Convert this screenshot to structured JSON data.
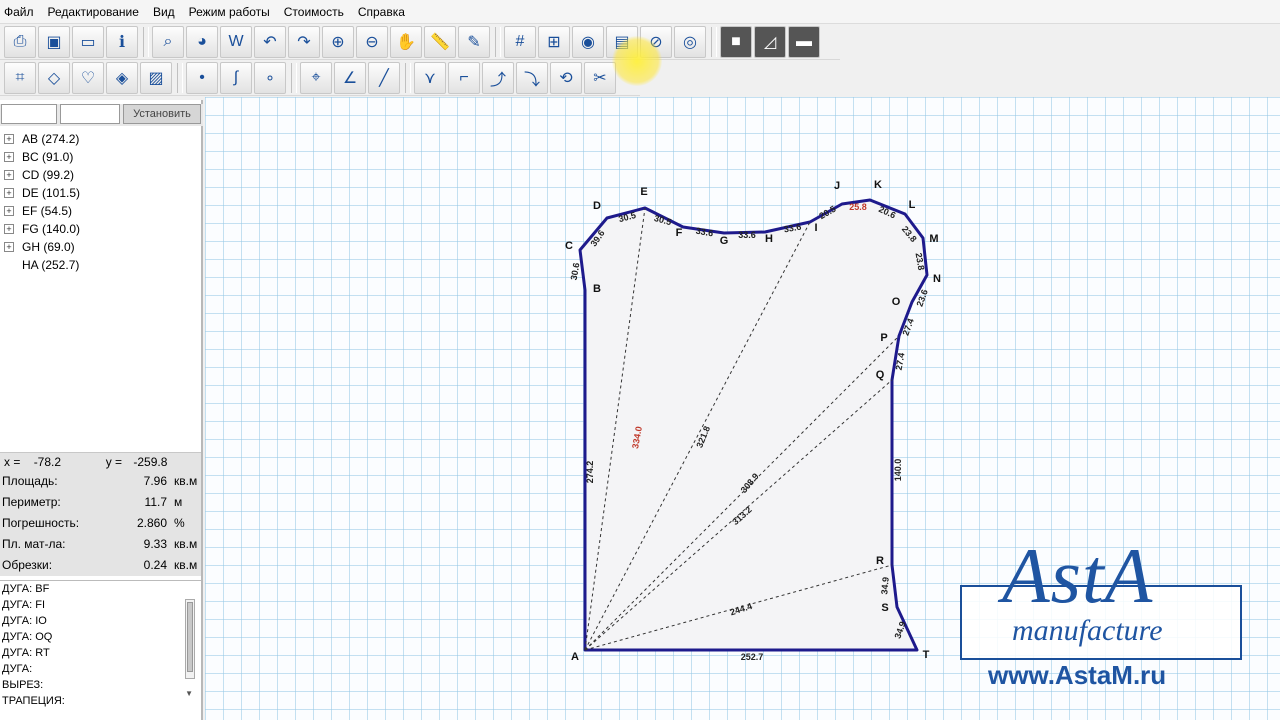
{
  "menu": [
    "Файл",
    "Редактирование",
    "Вид",
    "Режим работы",
    "Стоимость",
    "Справка"
  ],
  "toolbar1_icons": [
    "new-pattern-icon",
    "save-icon",
    "open-folder-icon",
    "info-icon",
    "zoom-page-icon",
    "pot-icon",
    "w-tool-icon",
    "curve-left-icon",
    "curve-right-icon",
    "zoom-in-icon",
    "zoom-out-icon",
    "hand-icon",
    "ruler-icon",
    "brush-icon",
    "grid-icon",
    "snap-grid-icon",
    "eye-icon",
    "layer-eye-icon",
    "eye-slash-icon",
    "eye-alt-icon",
    "gray-square-icon",
    "slope-icon",
    "line-icon"
  ],
  "toolbar2_icons": [
    "frame-icon",
    "diamond-icon",
    "heart-icon",
    "diamond-outline-icon",
    "image-icon",
    "point-icon",
    "curve-tool-icon",
    "point2-icon",
    "pin-icon",
    "angle-icon",
    "line2-icon",
    "dart-icon",
    "step-icon",
    "arrow-path-icon",
    "arrow-path2-icon",
    "rotate-icon",
    "cut-icon"
  ],
  "setbar": {
    "input1": "",
    "input2": "",
    "button": "Установить"
  },
  "tree": [
    {
      "label": "AB (274.2)",
      "expandable": true
    },
    {
      "label": "BC (91.0)",
      "expandable": true
    },
    {
      "label": "CD (99.2)",
      "expandable": true
    },
    {
      "label": "DE (101.5)",
      "expandable": true
    },
    {
      "label": "EF (54.5)",
      "expandable": true
    },
    {
      "label": "FG (140.0)",
      "expandable": true
    },
    {
      "label": "GH (69.0)",
      "expandable": true
    },
    {
      "label": "HA (252.7)",
      "expandable": false
    }
  ],
  "coords": {
    "x_label": "x =",
    "x": "-78.2",
    "y_label": "y =",
    "y": "-259.8"
  },
  "stats": [
    {
      "label": "Площадь:",
      "value": "7.96",
      "unit": "кв.м"
    },
    {
      "label": "Периметр:",
      "value": "11.7",
      "unit": "м"
    },
    {
      "label": "Погрешность:",
      "value": "2.860",
      "unit": "%"
    },
    {
      "label": "Пл. мат-ла:",
      "value": "9.33",
      "unit": "кв.м"
    },
    {
      "label": "Обрезки:",
      "value": "0.24",
      "unit": "кв.м"
    }
  ],
  "log": [
    "ДУГА: BF",
    "ДУГА: FI",
    "ДУГА: IO",
    "ДУГА: OQ",
    "ДУГА: RT",
    "ДУГА:",
    "ВЫРЕЗ:",
    "ТРАПЕЦИЯ:"
  ],
  "points": {
    "A": "A",
    "B": "B",
    "C": "C",
    "D": "D",
    "E": "E",
    "F": "F",
    "G": "G",
    "H": "H",
    "I": "I",
    "J": "J",
    "K": "K",
    "L": "L",
    "M": "M",
    "N": "N",
    "O": "O",
    "P": "P",
    "Q": "Q",
    "R": "R",
    "S": "S",
    "T": "T"
  },
  "edge_labels": {
    "AB": "274.2",
    "BC": "30.6",
    "CD": "39.6",
    "DE": "30.5",
    "EF": "30.5",
    "FG": "33.6",
    "GH": "33.6",
    "HI": "33.6",
    "IJ": "20.5",
    "JK": "25.8",
    "KL": "20.6",
    "LM": "23.8",
    "MN": "23.8",
    "NO": "23.6",
    "OP": "27.4",
    "PQ": "27.4",
    "QR": "140.0",
    "RS": "34.9",
    "ST": "34.9",
    "AT": "252.7"
  },
  "diagonals": {
    "AE": "334.0",
    "AI": "321.8",
    "AP": "308.9",
    "AQ": "313.2",
    "AR": "244.4"
  },
  "colors": {
    "outline": "#1e1a8c",
    "highlight_label": "#c0392b",
    "logo": "#1f55a2"
  },
  "logo": {
    "title": "AstA",
    "subtitle": "manufacture",
    "url": "www.AstaM.ru"
  }
}
